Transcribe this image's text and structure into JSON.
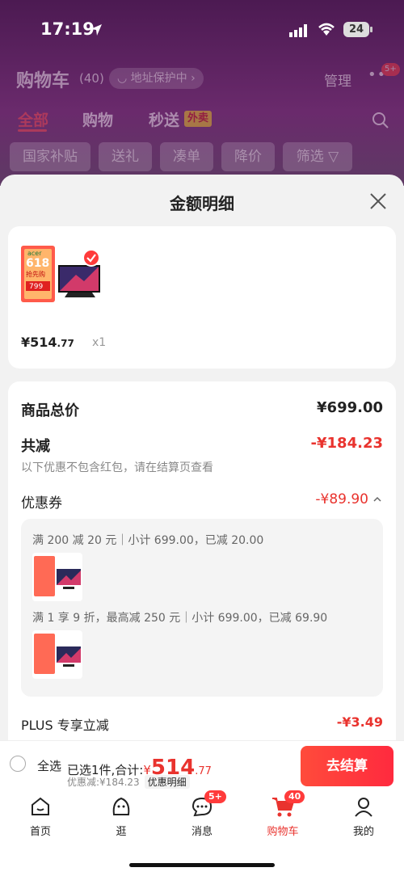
{
  "status": {
    "time": "17:19",
    "battery": "24"
  },
  "header": {
    "title": "购物车",
    "count": "(40)",
    "address": "◡ 地址保护中 ›",
    "manage": "管理",
    "more_badge": "5+"
  },
  "tabs": [
    {
      "label": "全部"
    },
    {
      "label": "购物"
    },
    {
      "label": "秒送"
    }
  ],
  "tab_badge": "外卖",
  "chips": [
    {
      "label": "国家补贴"
    },
    {
      "label": "送礼"
    },
    {
      "label": "凑单"
    },
    {
      "label": "降价"
    },
    {
      "label": "筛选 ▽"
    }
  ],
  "sheet": {
    "title": "金额明细",
    "product": {
      "brand": "acer",
      "promo": "618",
      "promo_sub": "抢先购",
      "price_tag": "799",
      "price": "¥514",
      "price_decimal": ".77",
      "qty": "x1"
    },
    "total_label": "商品总价",
    "total_value": "¥699.00",
    "reduce_label": "共减",
    "reduce_value": "-¥184.23",
    "note": "以下优惠不包含红包，请在结算页查看",
    "coupon_label": "优惠券",
    "coupon_value": "-¥89.90",
    "rule1": "满 200 减 20 元｜小计 699.00，已减 20.00",
    "rule2": "满 1 享 9 折，最高减 250 元｜小计 699.00，已减 69.90",
    "plus_label": "PLUS 专享立减",
    "plus_value": "-¥3.49"
  },
  "bottom": {
    "select_all": "全选",
    "selected": "已选1件,合计:",
    "total_symbol": "¥",
    "total_int": "514",
    "total_dec": ".77",
    "discount": "优惠减:¥184.23",
    "detail_btn": "优惠明细",
    "checkout": "去结算"
  },
  "tabbar": [
    {
      "label": "首页"
    },
    {
      "label": "逛"
    },
    {
      "label": "消息",
      "badge": "5+"
    },
    {
      "label": "购物车",
      "badge": "40"
    },
    {
      "label": "我的"
    }
  ],
  "colors": {
    "accent": "#e9332e",
    "header_bg": "#4c1a52"
  }
}
